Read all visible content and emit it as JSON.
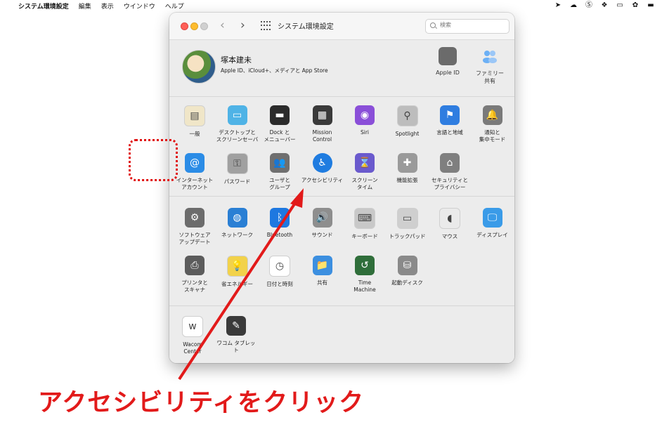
{
  "menubar": {
    "app": "システム環境設定",
    "items": [
      "編集",
      "表示",
      "ウインドウ",
      "ヘルプ"
    ]
  },
  "window": {
    "title": "システム環境設定",
    "search_placeholder": "検索"
  },
  "account": {
    "name": "塚本建未",
    "subtitle": "Apple ID、iCloud+、メディアと App Store",
    "apple_id_label": "Apple ID",
    "family_label": "ファミリー\n共有"
  },
  "panes_row1": [
    {
      "label": "一般",
      "icon": "general-icon",
      "color": "#f0e6c8"
    },
    {
      "label": "デスクトップと\nスクリーンセーバ",
      "icon": "desktop-icon",
      "color": "#4fb3e6"
    },
    {
      "label": "Dock と\nメニューバー",
      "icon": "dock-icon",
      "color": "#2b2b2b"
    },
    {
      "label": "Mission\nControl",
      "icon": "mission-control-icon",
      "color": "#3a3a3a"
    },
    {
      "label": "Siri",
      "icon": "siri-icon",
      "color": "#8a4fd8"
    },
    {
      "label": "Spotlight",
      "icon": "spotlight-icon",
      "color": "#bdbdbd"
    },
    {
      "label": "言語と地域",
      "icon": "language-icon",
      "color": "#2f7de0"
    },
    {
      "label": "通知と\n集中モード",
      "icon": "notification-icon",
      "color": "#7a7a7a"
    }
  ],
  "panes_row2": [
    {
      "label": "インターネット\nアカウント",
      "icon": "internet-accounts-icon",
      "color": "#2b8ce6"
    },
    {
      "label": "パスワード",
      "icon": "password-icon",
      "color": "#a0a0a0"
    },
    {
      "label": "ユーザと\nグループ",
      "icon": "users-icon",
      "color": "#6f6f6f"
    },
    {
      "label": "アクセシビリティ",
      "icon": "accessibility-icon",
      "color": "#1f7ce0"
    },
    {
      "label": "スクリーン\nタイム",
      "icon": "screen-time-icon",
      "color": "#6a5acd"
    },
    {
      "label": "機能拡張",
      "icon": "extensions-icon",
      "color": "#9a9a9a"
    },
    {
      "label": "セキュリティと\nプライバシー",
      "icon": "security-icon",
      "color": "#7f7f7f"
    }
  ],
  "panes_row3": [
    {
      "label": "ソフトウェア\nアップデート",
      "icon": "software-update-icon",
      "color": "#6c6c6c"
    },
    {
      "label": "ネットワーク",
      "icon": "network-icon",
      "color": "#2a7fd4"
    },
    {
      "label": "Bluetooth",
      "icon": "bluetooth-icon",
      "color": "#1e78e0"
    },
    {
      "label": "サウンド",
      "icon": "sound-icon",
      "color": "#8e8e8e"
    },
    {
      "label": "キーボード",
      "icon": "keyboard-icon",
      "color": "#c8c8c8"
    },
    {
      "label": "トラックパッド",
      "icon": "trackpad-icon",
      "color": "#cfcfcf"
    },
    {
      "label": "マウス",
      "icon": "mouse-icon",
      "color": "#eaeaea"
    },
    {
      "label": "ディスプレイ",
      "icon": "display-icon",
      "color": "#3a9be8"
    }
  ],
  "panes_row4": [
    {
      "label": "プリンタと\nスキャナ",
      "icon": "printer-icon",
      "color": "#5c5c5c"
    },
    {
      "label": "省エネルギー",
      "icon": "energy-saver-icon",
      "color": "#f2d24a"
    },
    {
      "label": "日付と時刻",
      "icon": "date-time-icon",
      "color": "#ffffff"
    },
    {
      "label": "共有",
      "icon": "sharing-icon",
      "color": "#3c8fe0"
    },
    {
      "label": "Time\nMachine",
      "icon": "time-machine-icon",
      "color": "#2f6e3a"
    },
    {
      "label": "起動ディスク",
      "icon": "startup-disk-icon",
      "color": "#8a8a8a"
    }
  ],
  "panes_row5": [
    {
      "label": "Wacom\nCenter",
      "icon": "wacom-center-icon",
      "color": "#ffffff"
    },
    {
      "label": "ワコム タブレット",
      "icon": "wacom-tablet-icon",
      "color": "#3a3a3a"
    }
  ],
  "annotation": {
    "text": "アクセシビリティをクリック",
    "color": "#e21a1a"
  }
}
